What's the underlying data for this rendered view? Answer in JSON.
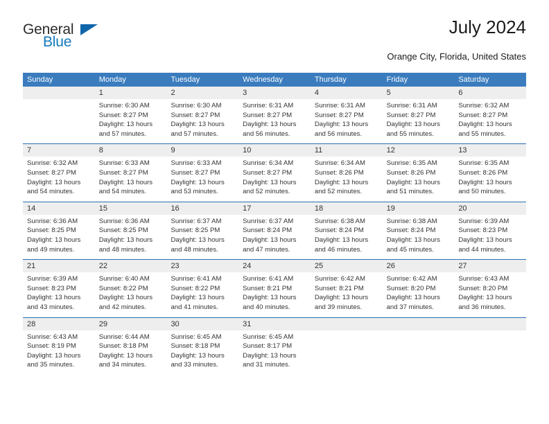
{
  "brand": {
    "word1": "General",
    "word2": "Blue",
    "triangle_color": "#1066ab",
    "blue_color": "#1479bd"
  },
  "header": {
    "title": "July 2024",
    "location": "Orange City, Florida, United States"
  },
  "theme": {
    "header_bar": "#3a7cbe",
    "week_divider": "#2a6db3",
    "day_number_bg": "#eeeeee",
    "text": "#333333"
  },
  "weekdays": [
    "Sunday",
    "Monday",
    "Tuesday",
    "Wednesday",
    "Thursday",
    "Friday",
    "Saturday"
  ],
  "labels": {
    "sunrise_prefix": "Sunrise:",
    "sunset_prefix": "Sunset:",
    "daylight_prefix": "Daylight:"
  },
  "weeks": [
    [
      {
        "day": "",
        "sunrise": "",
        "sunset": "",
        "daylight1": "",
        "daylight2": "",
        "empty": true
      },
      {
        "day": "1",
        "sunrise": "Sunrise: 6:30 AM",
        "sunset": "Sunset: 8:27 PM",
        "daylight1": "Daylight: 13 hours",
        "daylight2": "and 57 minutes."
      },
      {
        "day": "2",
        "sunrise": "Sunrise: 6:30 AM",
        "sunset": "Sunset: 8:27 PM",
        "daylight1": "Daylight: 13 hours",
        "daylight2": "and 57 minutes."
      },
      {
        "day": "3",
        "sunrise": "Sunrise: 6:31 AM",
        "sunset": "Sunset: 8:27 PM",
        "daylight1": "Daylight: 13 hours",
        "daylight2": "and 56 minutes."
      },
      {
        "day": "4",
        "sunrise": "Sunrise: 6:31 AM",
        "sunset": "Sunset: 8:27 PM",
        "daylight1": "Daylight: 13 hours",
        "daylight2": "and 56 minutes."
      },
      {
        "day": "5",
        "sunrise": "Sunrise: 6:31 AM",
        "sunset": "Sunset: 8:27 PM",
        "daylight1": "Daylight: 13 hours",
        "daylight2": "and 55 minutes."
      },
      {
        "day": "6",
        "sunrise": "Sunrise: 6:32 AM",
        "sunset": "Sunset: 8:27 PM",
        "daylight1": "Daylight: 13 hours",
        "daylight2": "and 55 minutes."
      }
    ],
    [
      {
        "day": "7",
        "sunrise": "Sunrise: 6:32 AM",
        "sunset": "Sunset: 8:27 PM",
        "daylight1": "Daylight: 13 hours",
        "daylight2": "and 54 minutes."
      },
      {
        "day": "8",
        "sunrise": "Sunrise: 6:33 AM",
        "sunset": "Sunset: 8:27 PM",
        "daylight1": "Daylight: 13 hours",
        "daylight2": "and 54 minutes."
      },
      {
        "day": "9",
        "sunrise": "Sunrise: 6:33 AM",
        "sunset": "Sunset: 8:27 PM",
        "daylight1": "Daylight: 13 hours",
        "daylight2": "and 53 minutes."
      },
      {
        "day": "10",
        "sunrise": "Sunrise: 6:34 AM",
        "sunset": "Sunset: 8:27 PM",
        "daylight1": "Daylight: 13 hours",
        "daylight2": "and 52 minutes."
      },
      {
        "day": "11",
        "sunrise": "Sunrise: 6:34 AM",
        "sunset": "Sunset: 8:26 PM",
        "daylight1": "Daylight: 13 hours",
        "daylight2": "and 52 minutes."
      },
      {
        "day": "12",
        "sunrise": "Sunrise: 6:35 AM",
        "sunset": "Sunset: 8:26 PM",
        "daylight1": "Daylight: 13 hours",
        "daylight2": "and 51 minutes."
      },
      {
        "day": "13",
        "sunrise": "Sunrise: 6:35 AM",
        "sunset": "Sunset: 8:26 PM",
        "daylight1": "Daylight: 13 hours",
        "daylight2": "and 50 minutes."
      }
    ],
    [
      {
        "day": "14",
        "sunrise": "Sunrise: 6:36 AM",
        "sunset": "Sunset: 8:25 PM",
        "daylight1": "Daylight: 13 hours",
        "daylight2": "and 49 minutes."
      },
      {
        "day": "15",
        "sunrise": "Sunrise: 6:36 AM",
        "sunset": "Sunset: 8:25 PM",
        "daylight1": "Daylight: 13 hours",
        "daylight2": "and 48 minutes."
      },
      {
        "day": "16",
        "sunrise": "Sunrise: 6:37 AM",
        "sunset": "Sunset: 8:25 PM",
        "daylight1": "Daylight: 13 hours",
        "daylight2": "and 48 minutes."
      },
      {
        "day": "17",
        "sunrise": "Sunrise: 6:37 AM",
        "sunset": "Sunset: 8:24 PM",
        "daylight1": "Daylight: 13 hours",
        "daylight2": "and 47 minutes."
      },
      {
        "day": "18",
        "sunrise": "Sunrise: 6:38 AM",
        "sunset": "Sunset: 8:24 PM",
        "daylight1": "Daylight: 13 hours",
        "daylight2": "and 46 minutes."
      },
      {
        "day": "19",
        "sunrise": "Sunrise: 6:38 AM",
        "sunset": "Sunset: 8:24 PM",
        "daylight1": "Daylight: 13 hours",
        "daylight2": "and 45 minutes."
      },
      {
        "day": "20",
        "sunrise": "Sunrise: 6:39 AM",
        "sunset": "Sunset: 8:23 PM",
        "daylight1": "Daylight: 13 hours",
        "daylight2": "and 44 minutes."
      }
    ],
    [
      {
        "day": "21",
        "sunrise": "Sunrise: 6:39 AM",
        "sunset": "Sunset: 8:23 PM",
        "daylight1": "Daylight: 13 hours",
        "daylight2": "and 43 minutes."
      },
      {
        "day": "22",
        "sunrise": "Sunrise: 6:40 AM",
        "sunset": "Sunset: 8:22 PM",
        "daylight1": "Daylight: 13 hours",
        "daylight2": "and 42 minutes."
      },
      {
        "day": "23",
        "sunrise": "Sunrise: 6:41 AM",
        "sunset": "Sunset: 8:22 PM",
        "daylight1": "Daylight: 13 hours",
        "daylight2": "and 41 minutes."
      },
      {
        "day": "24",
        "sunrise": "Sunrise: 6:41 AM",
        "sunset": "Sunset: 8:21 PM",
        "daylight1": "Daylight: 13 hours",
        "daylight2": "and 40 minutes."
      },
      {
        "day": "25",
        "sunrise": "Sunrise: 6:42 AM",
        "sunset": "Sunset: 8:21 PM",
        "daylight1": "Daylight: 13 hours",
        "daylight2": "and 39 minutes."
      },
      {
        "day": "26",
        "sunrise": "Sunrise: 6:42 AM",
        "sunset": "Sunset: 8:20 PM",
        "daylight1": "Daylight: 13 hours",
        "daylight2": "and 37 minutes."
      },
      {
        "day": "27",
        "sunrise": "Sunrise: 6:43 AM",
        "sunset": "Sunset: 8:20 PM",
        "daylight1": "Daylight: 13 hours",
        "daylight2": "and 36 minutes."
      }
    ],
    [
      {
        "day": "28",
        "sunrise": "Sunrise: 6:43 AM",
        "sunset": "Sunset: 8:19 PM",
        "daylight1": "Daylight: 13 hours",
        "daylight2": "and 35 minutes."
      },
      {
        "day": "29",
        "sunrise": "Sunrise: 6:44 AM",
        "sunset": "Sunset: 8:18 PM",
        "daylight1": "Daylight: 13 hours",
        "daylight2": "and 34 minutes."
      },
      {
        "day": "30",
        "sunrise": "Sunrise: 6:45 AM",
        "sunset": "Sunset: 8:18 PM",
        "daylight1": "Daylight: 13 hours",
        "daylight2": "and 33 minutes."
      },
      {
        "day": "31",
        "sunrise": "Sunrise: 6:45 AM",
        "sunset": "Sunset: 8:17 PM",
        "daylight1": "Daylight: 13 hours",
        "daylight2": "and 31 minutes."
      },
      {
        "day": "",
        "sunrise": "",
        "sunset": "",
        "daylight1": "",
        "daylight2": "",
        "empty": true
      },
      {
        "day": "",
        "sunrise": "",
        "sunset": "",
        "daylight1": "",
        "daylight2": "",
        "empty": true
      },
      {
        "day": "",
        "sunrise": "",
        "sunset": "",
        "daylight1": "",
        "daylight2": "",
        "empty": true
      }
    ]
  ]
}
